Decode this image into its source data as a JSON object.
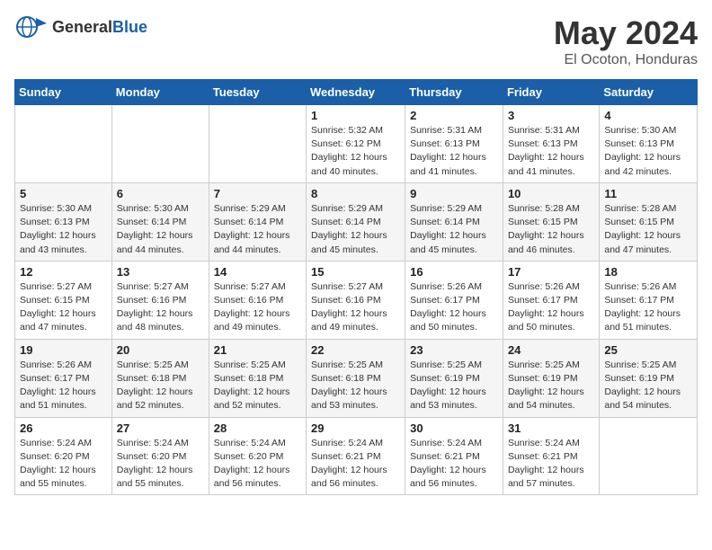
{
  "header": {
    "logo_general": "General",
    "logo_blue": "Blue",
    "month_title": "May 2024",
    "location": "El Ocoton, Honduras"
  },
  "days_of_week": [
    "Sunday",
    "Monday",
    "Tuesday",
    "Wednesday",
    "Thursday",
    "Friday",
    "Saturday"
  ],
  "weeks": [
    [
      {
        "day": "",
        "info": ""
      },
      {
        "day": "",
        "info": ""
      },
      {
        "day": "",
        "info": ""
      },
      {
        "day": "1",
        "info": "Sunrise: 5:32 AM\nSunset: 6:12 PM\nDaylight: 12 hours\nand 40 minutes."
      },
      {
        "day": "2",
        "info": "Sunrise: 5:31 AM\nSunset: 6:13 PM\nDaylight: 12 hours\nand 41 minutes."
      },
      {
        "day": "3",
        "info": "Sunrise: 5:31 AM\nSunset: 6:13 PM\nDaylight: 12 hours\nand 41 minutes."
      },
      {
        "day": "4",
        "info": "Sunrise: 5:30 AM\nSunset: 6:13 PM\nDaylight: 12 hours\nand 42 minutes."
      }
    ],
    [
      {
        "day": "5",
        "info": "Sunrise: 5:30 AM\nSunset: 6:13 PM\nDaylight: 12 hours\nand 43 minutes."
      },
      {
        "day": "6",
        "info": "Sunrise: 5:30 AM\nSunset: 6:14 PM\nDaylight: 12 hours\nand 44 minutes."
      },
      {
        "day": "7",
        "info": "Sunrise: 5:29 AM\nSunset: 6:14 PM\nDaylight: 12 hours\nand 44 minutes."
      },
      {
        "day": "8",
        "info": "Sunrise: 5:29 AM\nSunset: 6:14 PM\nDaylight: 12 hours\nand 45 minutes."
      },
      {
        "day": "9",
        "info": "Sunrise: 5:29 AM\nSunset: 6:14 PM\nDaylight: 12 hours\nand 45 minutes."
      },
      {
        "day": "10",
        "info": "Sunrise: 5:28 AM\nSunset: 6:15 PM\nDaylight: 12 hours\nand 46 minutes."
      },
      {
        "day": "11",
        "info": "Sunrise: 5:28 AM\nSunset: 6:15 PM\nDaylight: 12 hours\nand 47 minutes."
      }
    ],
    [
      {
        "day": "12",
        "info": "Sunrise: 5:27 AM\nSunset: 6:15 PM\nDaylight: 12 hours\nand 47 minutes."
      },
      {
        "day": "13",
        "info": "Sunrise: 5:27 AM\nSunset: 6:16 PM\nDaylight: 12 hours\nand 48 minutes."
      },
      {
        "day": "14",
        "info": "Sunrise: 5:27 AM\nSunset: 6:16 PM\nDaylight: 12 hours\nand 49 minutes."
      },
      {
        "day": "15",
        "info": "Sunrise: 5:27 AM\nSunset: 6:16 PM\nDaylight: 12 hours\nand 49 minutes."
      },
      {
        "day": "16",
        "info": "Sunrise: 5:26 AM\nSunset: 6:17 PM\nDaylight: 12 hours\nand 50 minutes."
      },
      {
        "day": "17",
        "info": "Sunrise: 5:26 AM\nSunset: 6:17 PM\nDaylight: 12 hours\nand 50 minutes."
      },
      {
        "day": "18",
        "info": "Sunrise: 5:26 AM\nSunset: 6:17 PM\nDaylight: 12 hours\nand 51 minutes."
      }
    ],
    [
      {
        "day": "19",
        "info": "Sunrise: 5:26 AM\nSunset: 6:17 PM\nDaylight: 12 hours\nand 51 minutes."
      },
      {
        "day": "20",
        "info": "Sunrise: 5:25 AM\nSunset: 6:18 PM\nDaylight: 12 hours\nand 52 minutes."
      },
      {
        "day": "21",
        "info": "Sunrise: 5:25 AM\nSunset: 6:18 PM\nDaylight: 12 hours\nand 52 minutes."
      },
      {
        "day": "22",
        "info": "Sunrise: 5:25 AM\nSunset: 6:18 PM\nDaylight: 12 hours\nand 53 minutes."
      },
      {
        "day": "23",
        "info": "Sunrise: 5:25 AM\nSunset: 6:19 PM\nDaylight: 12 hours\nand 53 minutes."
      },
      {
        "day": "24",
        "info": "Sunrise: 5:25 AM\nSunset: 6:19 PM\nDaylight: 12 hours\nand 54 minutes."
      },
      {
        "day": "25",
        "info": "Sunrise: 5:25 AM\nSunset: 6:19 PM\nDaylight: 12 hours\nand 54 minutes."
      }
    ],
    [
      {
        "day": "26",
        "info": "Sunrise: 5:24 AM\nSunset: 6:20 PM\nDaylight: 12 hours\nand 55 minutes."
      },
      {
        "day": "27",
        "info": "Sunrise: 5:24 AM\nSunset: 6:20 PM\nDaylight: 12 hours\nand 55 minutes."
      },
      {
        "day": "28",
        "info": "Sunrise: 5:24 AM\nSunset: 6:20 PM\nDaylight: 12 hours\nand 56 minutes."
      },
      {
        "day": "29",
        "info": "Sunrise: 5:24 AM\nSunset: 6:21 PM\nDaylight: 12 hours\nand 56 minutes."
      },
      {
        "day": "30",
        "info": "Sunrise: 5:24 AM\nSunset: 6:21 PM\nDaylight: 12 hours\nand 56 minutes."
      },
      {
        "day": "31",
        "info": "Sunrise: 5:24 AM\nSunset: 6:21 PM\nDaylight: 12 hours\nand 57 minutes."
      },
      {
        "day": "",
        "info": ""
      }
    ]
  ]
}
